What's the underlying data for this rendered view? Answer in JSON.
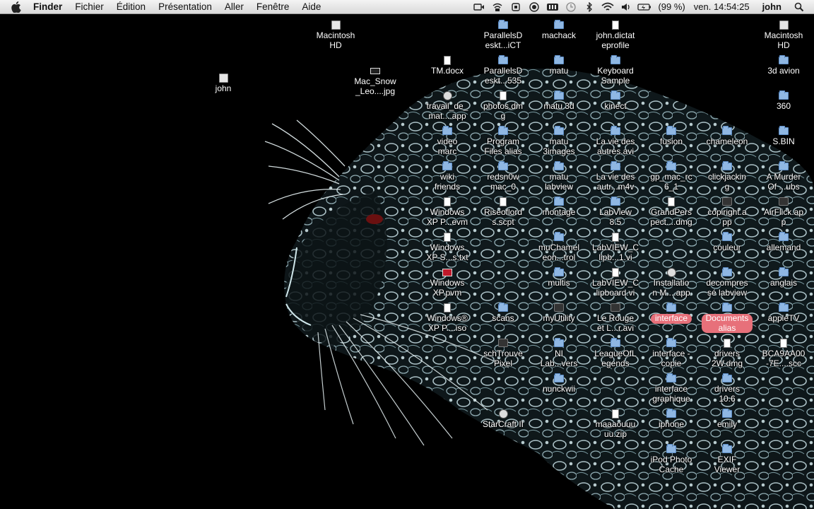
{
  "menubar": {
    "app_name": "Finder",
    "menus": [
      "Fichier",
      "Édition",
      "Présentation",
      "Aller",
      "Fenêtre",
      "Aide"
    ],
    "battery": "(99 %)",
    "clock": "ven. 14:54:25",
    "user": "john"
  },
  "icons": [
    {
      "label": "Macintosh\nHD",
      "icon": "drive-icon",
      "kind": "drive"
    },
    {
      "label": "john",
      "icon": "home-drive-icon",
      "kind": "drive"
    },
    {
      "label": "Mac_Snow\n_Leo....jpg",
      "icon": "image-icon",
      "kind": "img"
    },
    {
      "label": "TM.docx",
      "icon": "document-icon",
      "kind": "doc"
    },
    {
      "label": "travail_de_\nmat....app",
      "icon": "app-icon",
      "kind": "app"
    },
    {
      "label": "video\nmarc",
      "icon": "folder-icon",
      "kind": "folder"
    },
    {
      "label": "wiki\nfriends",
      "icon": "folder-icon",
      "kind": "folder"
    },
    {
      "label": "Windows\nXP P...evm",
      "icon": "document-icon",
      "kind": "doc"
    },
    {
      "label": "Windows\nXP S...s.txt",
      "icon": "document-icon",
      "kind": "doc"
    },
    {
      "label": "Windows\nXP.pvm",
      "icon": "vm-icon",
      "kind": "red"
    },
    {
      "label": "Windows®\nXP P....iso",
      "icon": "document-icon",
      "kind": "doc"
    },
    {
      "label": "ParallelsD\neskt...iCT",
      "icon": "folder-icon",
      "kind": "folder"
    },
    {
      "label": "ParallelsD\neskt...535",
      "icon": "folder-icon",
      "kind": "folder"
    },
    {
      "label": "photos.dm\ng",
      "icon": "document-icon",
      "kind": "doc"
    },
    {
      "label": "Program\nFiles alias",
      "icon": "folder-icon",
      "kind": "folder"
    },
    {
      "label": "redsn0w\nmac_0",
      "icon": "folder-icon",
      "kind": "folder"
    },
    {
      "label": "Riseoflord\ns.scpt",
      "icon": "document-icon",
      "kind": "doc"
    },
    {
      "label": "scans",
      "icon": "folder-icon",
      "kind": "folder"
    },
    {
      "label": "schTrouve\nPixel",
      "icon": "app-icon",
      "kind": "dark"
    },
    {
      "label": "StarCraft II",
      "icon": "app-icon",
      "kind": "app"
    },
    {
      "label": "machack",
      "icon": "folder-icon",
      "kind": "folder"
    },
    {
      "label": "matu",
      "icon": "folder-icon",
      "kind": "folder"
    },
    {
      "label": "matu 3d",
      "icon": "folder-icon",
      "kind": "folder"
    },
    {
      "label": "matu\n3images",
      "icon": "folder-icon",
      "kind": "folder"
    },
    {
      "label": "matu\nlabview",
      "icon": "folder-icon",
      "kind": "folder"
    },
    {
      "label": "montage",
      "icon": "folder-icon",
      "kind": "folder"
    },
    {
      "label": "muChamel\neon...trol",
      "icon": "folder-icon",
      "kind": "folder"
    },
    {
      "label": "multis",
      "icon": "folder-icon",
      "kind": "folder"
    },
    {
      "label": "myUtility",
      "icon": "app-icon",
      "kind": "dark"
    },
    {
      "label": "NI\nLab...vers",
      "icon": "folder-icon",
      "kind": "folder"
    },
    {
      "label": "nunckwii",
      "icon": "folder-icon",
      "kind": "folder"
    },
    {
      "label": "john.dictat\neprofile",
      "icon": "document-icon",
      "kind": "doc"
    },
    {
      "label": "Keyboard\nSample",
      "icon": "folder-icon",
      "kind": "folder"
    },
    {
      "label": "kinect",
      "icon": "folder-icon",
      "kind": "folder"
    },
    {
      "label": "La vie des\nautres.avi",
      "icon": "folder-icon",
      "kind": "folder"
    },
    {
      "label": "La vie des\nautr...m4v",
      "icon": "folder-icon",
      "kind": "folder"
    },
    {
      "label": "LabView\n8.5",
      "icon": "folder-icon",
      "kind": "folder"
    },
    {
      "label": "LabVIEW_C\nlipb...1.vi",
      "icon": "document-icon",
      "kind": "doc"
    },
    {
      "label": "LabVIEW_C\nlipboard.vi",
      "icon": "document-icon",
      "kind": "doc"
    },
    {
      "label": "Le Rouge\net L...r.avi",
      "icon": "movie-icon",
      "kind": "dark"
    },
    {
      "label": "LeagueOfL\negends",
      "icon": "folder-icon",
      "kind": "folder"
    },
    {
      "label": "maaaouuu\nuu.zip",
      "icon": "document-icon",
      "kind": "doc"
    },
    {
      "label": "fusion",
      "icon": "folder-icon",
      "kind": "folder"
    },
    {
      "label": "gp_mac_rc\n6_1",
      "icon": "folder-icon",
      "kind": "folder"
    },
    {
      "label": "GrandPers\npect....dmg",
      "icon": "document-icon",
      "kind": "doc"
    },
    {
      "label": "Installatio\nn M....app",
      "icon": "app-icon",
      "kind": "app"
    },
    {
      "label": "interface",
      "icon": "folder-icon",
      "kind": "folder",
      "tag": true
    },
    {
      "label": "interface -\ncopie",
      "icon": "folder-icon",
      "kind": "folder"
    },
    {
      "label": "interface\ngraphique",
      "icon": "folder-icon",
      "kind": "folder"
    },
    {
      "label": "iphone",
      "icon": "folder-icon",
      "kind": "folder"
    },
    {
      "label": "iPod Photo\nCache",
      "icon": "folder-icon",
      "kind": "folder"
    },
    {
      "label": "chameleon",
      "icon": "folder-icon",
      "kind": "folder"
    },
    {
      "label": "clickjackin\ng",
      "icon": "folder-icon",
      "kind": "folder"
    },
    {
      "label": "copiright.a\npp",
      "icon": "app-icon",
      "kind": "dark"
    },
    {
      "label": "couleur",
      "icon": "folder-icon",
      "kind": "folder"
    },
    {
      "label": "decompres\nsé labview",
      "icon": "folder-icon",
      "kind": "folder"
    },
    {
      "label": "Documents\nalias",
      "icon": "folder-icon",
      "kind": "folder",
      "tag": true
    },
    {
      "label": "drivers\n2W.dmg",
      "icon": "document-icon",
      "kind": "doc"
    },
    {
      "label": "drivers\n10.6",
      "icon": "folder-icon",
      "kind": "folder"
    },
    {
      "label": "emily",
      "icon": "folder-icon",
      "kind": "folder"
    },
    {
      "label": "EXIF\nViewer",
      "icon": "folder-icon",
      "kind": "folder"
    },
    {
      "label": "Macintosh\nHD",
      "icon": "drive-icon",
      "kind": "drive"
    },
    {
      "label": "3d avion",
      "icon": "folder-icon",
      "kind": "folder"
    },
    {
      "label": "360",
      "icon": "folder-icon",
      "kind": "folder"
    },
    {
      "label": "S.BIN",
      "icon": "folder-icon",
      "kind": "folder"
    },
    {
      "label": "A Murder\nOf ...ubs",
      "icon": "folder-icon",
      "kind": "folder"
    },
    {
      "label": "AirFlick.ap\np",
      "icon": "app-icon",
      "kind": "dark"
    },
    {
      "label": "allemand",
      "icon": "folder-icon",
      "kind": "folder"
    },
    {
      "label": "anglais",
      "icon": "folder-icon",
      "kind": "folder"
    },
    {
      "label": "appleTV",
      "icon": "folder-icon",
      "kind": "folder"
    },
    {
      "label": "BCA9AA00\n-7E....scc",
      "icon": "document-icon",
      "kind": "doc"
    }
  ]
}
